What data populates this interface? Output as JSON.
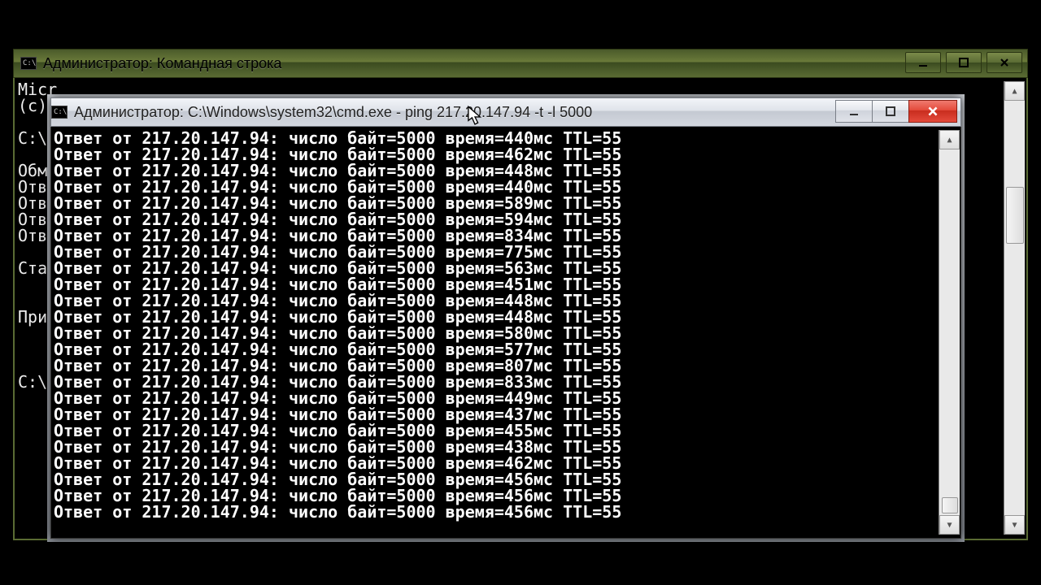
{
  "back_window": {
    "title": "Администратор: Командная строка",
    "content_lines": [
      "Micr",
      "(c) ",
      "",
      "C:\\",
      "",
      "Обм",
      "Отв",
      "Отв",
      "Отв",
      "Отв",
      "",
      "Ста",
      "",
      "",
      "При",
      "",
      "",
      "",
      "C:\\"
    ]
  },
  "front_window": {
    "title": "Администратор: C:\\Windows\\system32\\cmd.exe - ping  217.20.147.94 -t -l 5000",
    "ip": "217.20.147.94",
    "bytes": 5000,
    "ttl": 55,
    "times_ms": [
      440,
      462,
      448,
      440,
      589,
      594,
      834,
      775,
      563,
      451,
      448,
      448,
      580,
      577,
      807,
      833,
      449,
      437,
      455,
      438,
      462,
      456,
      456,
      456
    ]
  },
  "buttons": {
    "min": "minimize",
    "max": "maximize",
    "close": "close"
  }
}
